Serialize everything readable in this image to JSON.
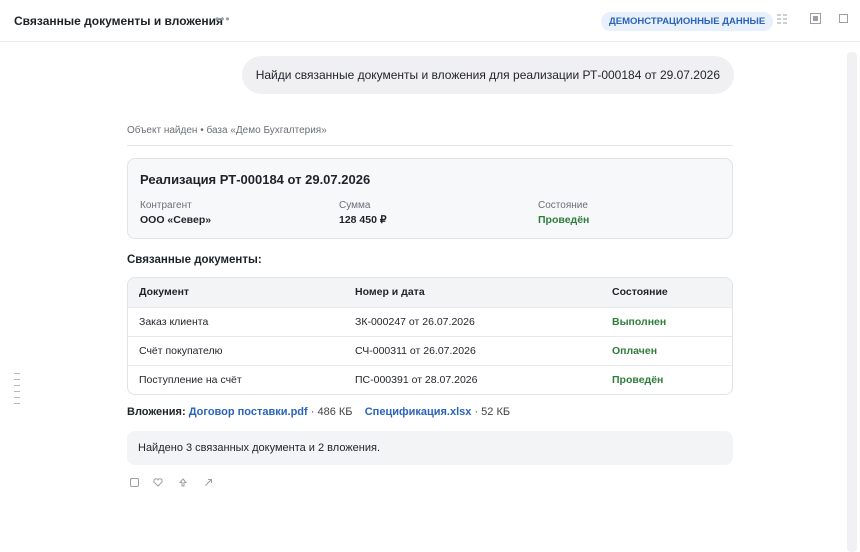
{
  "header": {
    "title": "Связанные документы и вложения",
    "more_glyph": "•••",
    "demo_badge": "ДЕМОНСТРАЦИОННЫЕ ДАННЫЕ",
    "icons": [
      "grid-icon",
      "panel-icon",
      "window-icon"
    ]
  },
  "chat": {
    "user_message": "Найди связанные документы и вложения для реализации РТ-000184 от 29.07.2026",
    "meta_line": "Объект найден • база «Демо Бухгалтерия»"
  },
  "card": {
    "title": "Реализация РТ-000184 от 29.07.2026",
    "fields": [
      {
        "label": "Контрагент",
        "value": "ООО «Север»"
      },
      {
        "label": "Сумма",
        "value": "128 450 ₽"
      },
      {
        "label": "Состояние",
        "value": "Проведён"
      }
    ]
  },
  "related": {
    "heading": "Связанные документы:",
    "columns": [
      "Документ",
      "Номер и дата",
      "Состояние"
    ],
    "rows": [
      [
        "Заказ клиента",
        "ЗК-000247 от 26.07.2026",
        "Выполнен"
      ],
      [
        "Счёт покупателю",
        "СЧ-000311 от 26.07.2026",
        "Оплачен"
      ],
      [
        "Поступление на счёт",
        "ПС-000391 от 28.07.2026",
        "Проведён"
      ]
    ]
  },
  "attachments": {
    "label": "Вложения:",
    "items": [
      {
        "name": "Договор поставки.pdf",
        "size": " · 486 КБ"
      },
      {
        "name": "Спецификация.xlsx",
        "size": " · 52 КБ"
      }
    ]
  },
  "summary": "Найдено 3 связанных документа и 2 вложения.",
  "actions": [
    "copy-icon",
    "heart-icon",
    "share-icon",
    "external-link-icon"
  ],
  "colors": {
    "accent": "#2a63b8",
    "status_green": "#2f7d3c",
    "badge_bg": "#e8f0fc"
  }
}
